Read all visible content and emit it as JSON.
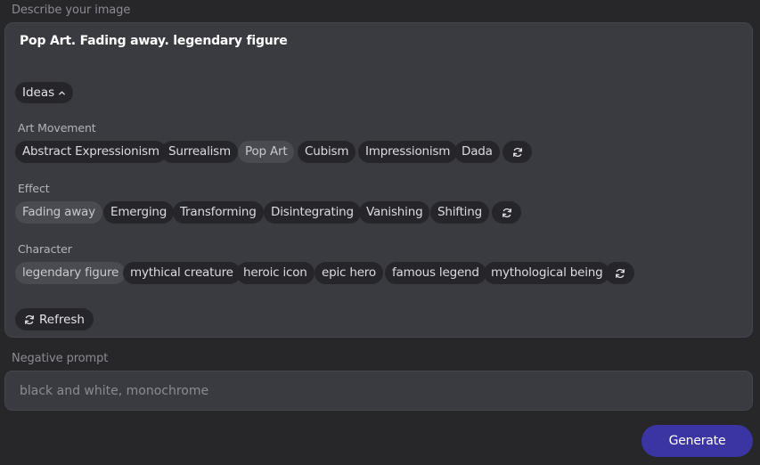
{
  "describe_label": "Describe your image",
  "prompt_text": "Pop Art. Fading away. legendary figure",
  "ideas_label": "Ideas",
  "groups": [
    {
      "label": "Art Movement",
      "chips": [
        "Abstract Expressionism",
        "Surrealism",
        "Pop Art",
        "Cubism",
        "Impressionism",
        "Dada"
      ],
      "selected": "Pop Art"
    },
    {
      "label": "Effect",
      "chips": [
        "Fading away",
        "Emerging",
        "Transforming",
        "Disintegrating",
        "Vanishing",
        "Shifting"
      ],
      "selected": "Fading away"
    },
    {
      "label": "Character",
      "chips": [
        "legendary figure",
        "mythical creature",
        "heroic icon",
        "epic hero",
        "famous legend",
        "mythological being"
      ],
      "selected": "legendary figure"
    }
  ],
  "refresh_label": "Refresh",
  "negative_label": "Negative prompt",
  "negative_placeholder": "black and white, monochrome",
  "generate_label": "Generate",
  "colors": {
    "accent": "#3b35a3",
    "panel": "#3a3a41",
    "chip": "#25252a",
    "chip_selected": "#4a4a51"
  },
  "icons": {
    "ideas_toggle": "chevron-up-icon",
    "shuffle": "refresh-icon"
  }
}
